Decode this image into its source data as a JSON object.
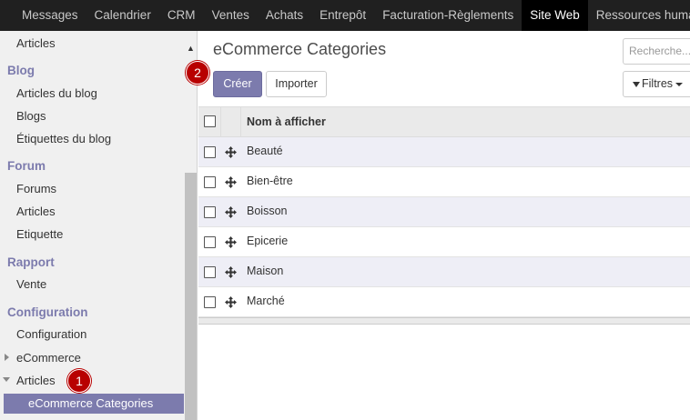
{
  "topnav": {
    "items": [
      "Messages",
      "Calendrier",
      "CRM",
      "Ventes",
      "Achats",
      "Entrepôt",
      "Facturation-Règlements",
      "Site Web",
      "Ressources humaines"
    ],
    "active": "Site Web"
  },
  "sidebar": {
    "top_cut_item": "Articles",
    "sections": [
      {
        "title": "Blog",
        "items": [
          "Articles du blog",
          "Blogs",
          "Étiquettes du blog"
        ]
      },
      {
        "title": "Forum",
        "items": [
          "Forums",
          "Articles",
          "Etiquette"
        ]
      },
      {
        "title": "Rapport",
        "items": [
          "Vente"
        ]
      },
      {
        "title": "Configuration",
        "items": [
          "Configuration"
        ]
      }
    ],
    "tree": {
      "ecommerce": "eCommerce",
      "articles": "Articles",
      "active_child": "eCommerce Categories"
    }
  },
  "main": {
    "title": "eCommerce Categories",
    "create_label": "Créer",
    "import_label": "Importer",
    "search_placeholder": "Recherche...",
    "filters_label": "Filtres"
  },
  "table": {
    "header": "Nom à afficher",
    "rows": [
      "Beauté",
      "Bien-être",
      "Boisson",
      "Epicerie",
      "Maison",
      "Marché"
    ]
  },
  "badges": {
    "one": "1",
    "two": "2"
  },
  "colors": {
    "accent": "#7c7bad",
    "badge": "#b80000",
    "topnav_bg": "#202020"
  }
}
